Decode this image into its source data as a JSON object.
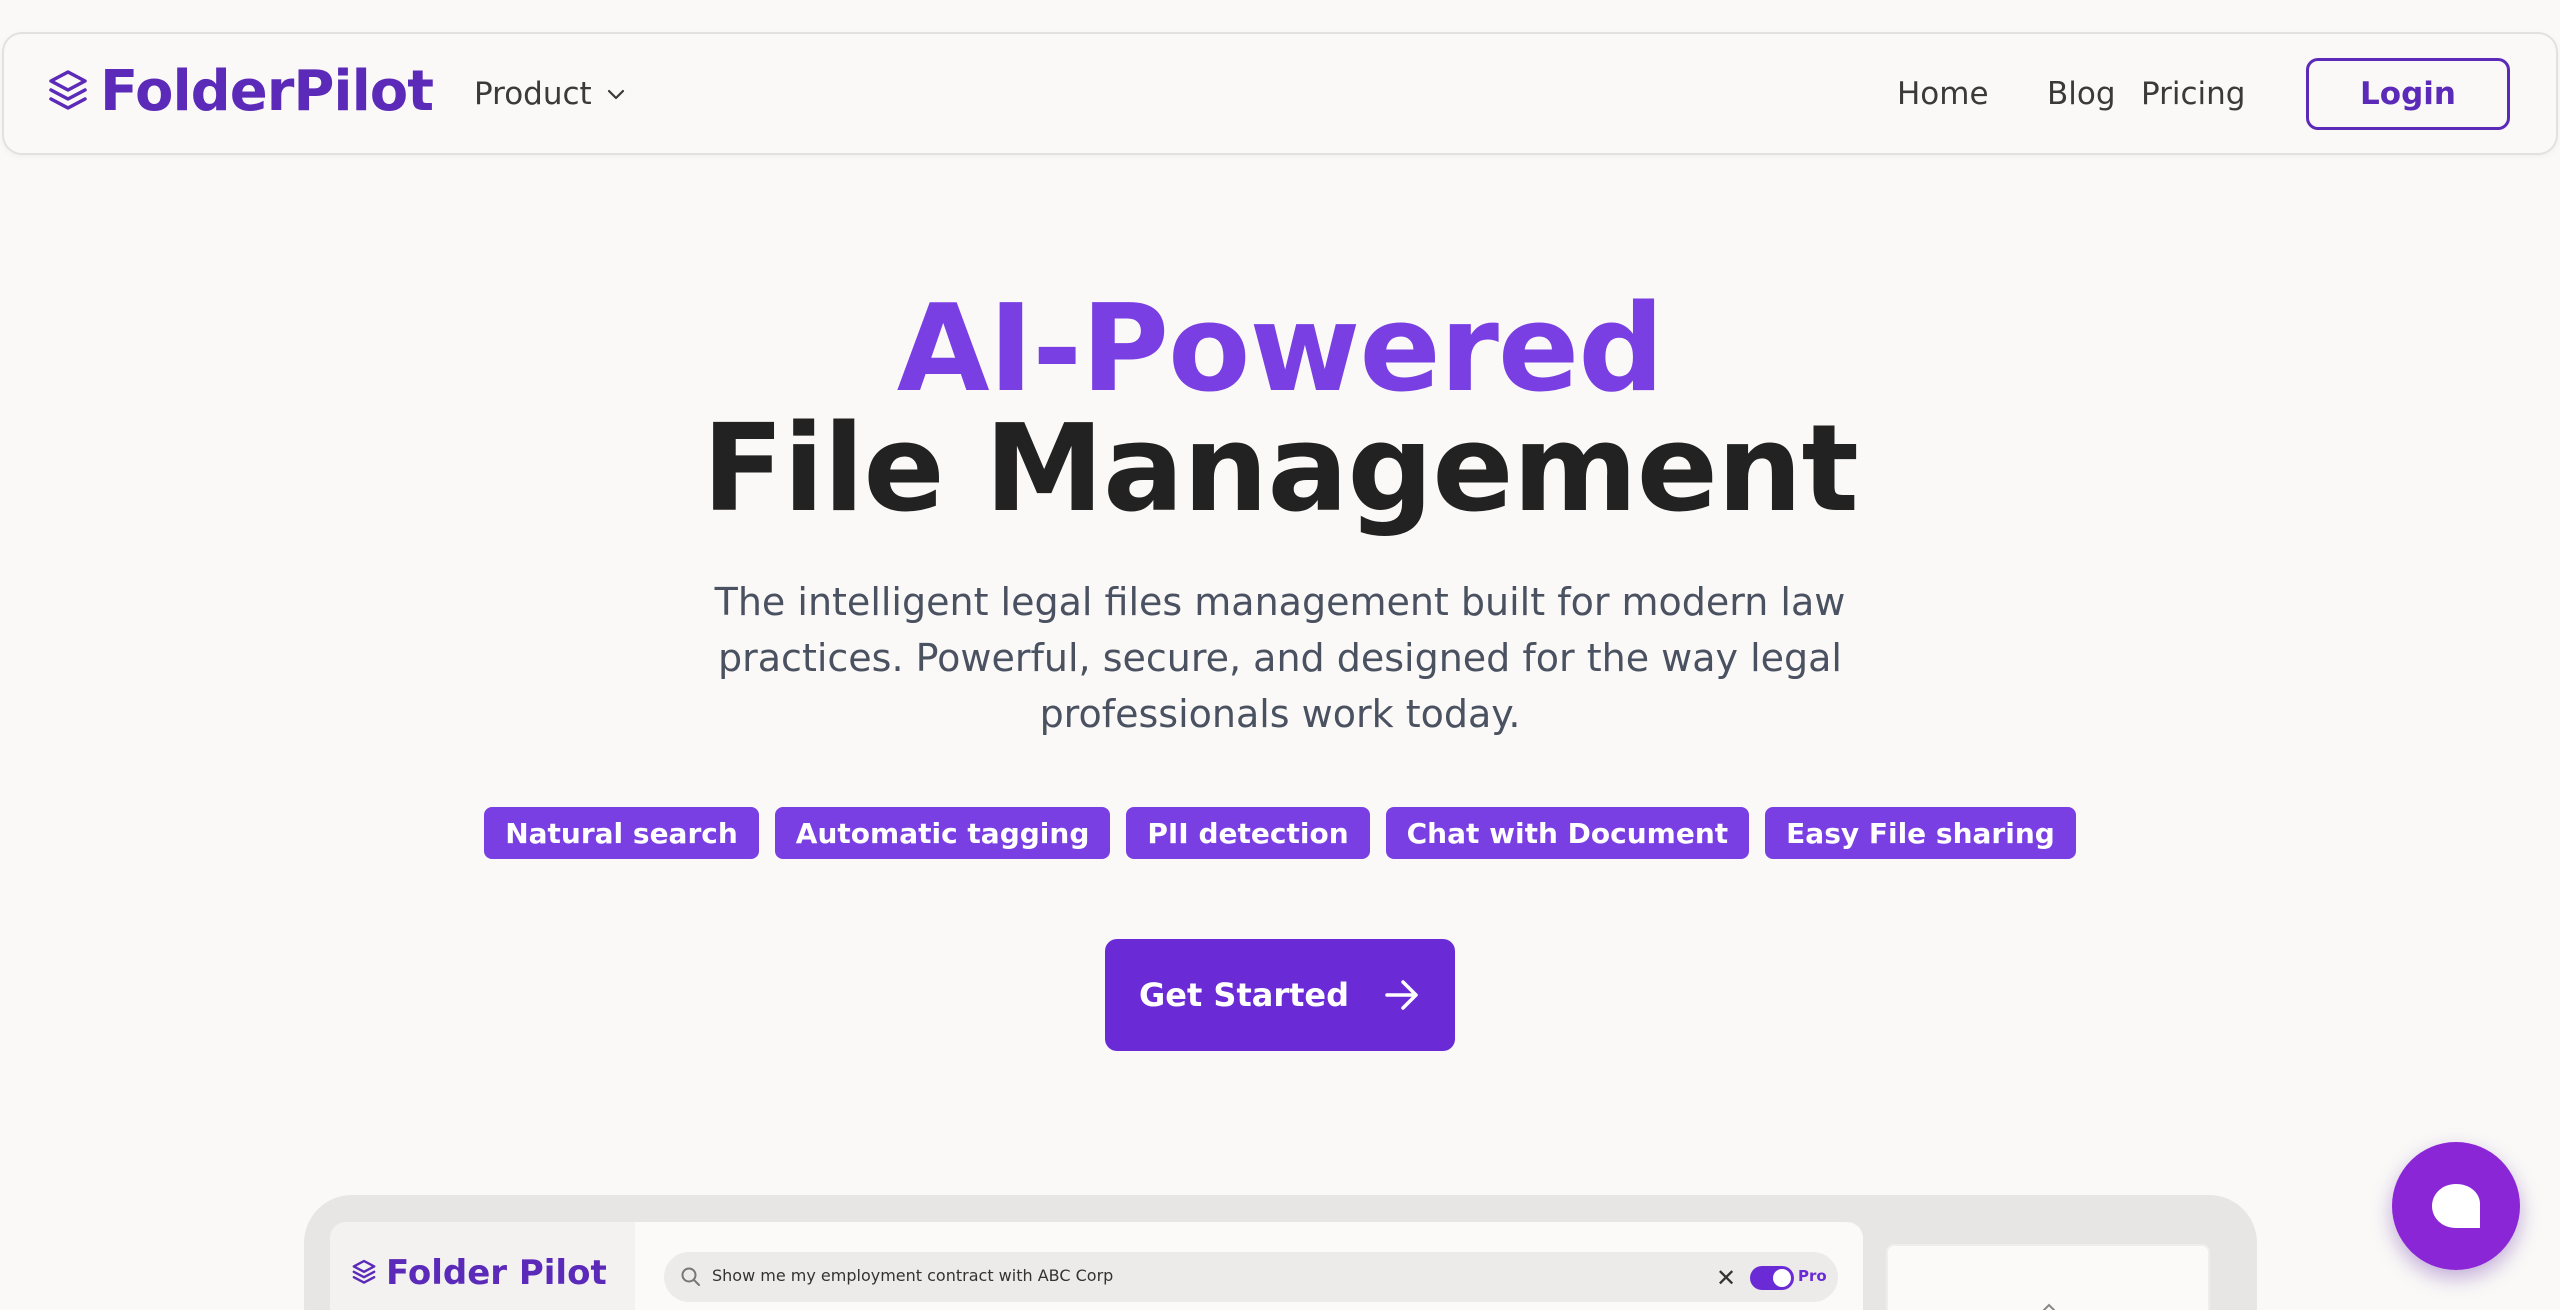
{
  "nav": {
    "brand": "FolderPilot",
    "product_label": "Product",
    "links": [
      "Home",
      "Blog",
      "Pricing"
    ],
    "login_label": "Login"
  },
  "hero": {
    "title_accent": "AI-Powered",
    "title_main": "File Management",
    "subtitle": "The intelligent legal files management built for modern law practices. Powerful, secure, and designed for the way legal professionals work today.",
    "tags": [
      "Natural search",
      "Automatic tagging",
      "PII detection",
      "Chat with Document",
      "Easy File sharing"
    ],
    "cta_label": "Get Started"
  },
  "preview": {
    "brand": "Folder Pilot",
    "search_value": "Show me my employment contract with ABC Corp",
    "pro_label": "Pro"
  },
  "colors": {
    "brand": "#5b2ab8",
    "accent": "#7a3fe3",
    "cta": "#6a2bd6",
    "chat": "#8a26d6",
    "background": "#faf9f7"
  },
  "icons": {
    "logo": "layers-icon",
    "product_dropdown": "chevron-down-icon",
    "cta": "arrow-right-icon",
    "search": "search-icon",
    "clear": "close-icon",
    "chat": "chat-bubble-icon"
  }
}
